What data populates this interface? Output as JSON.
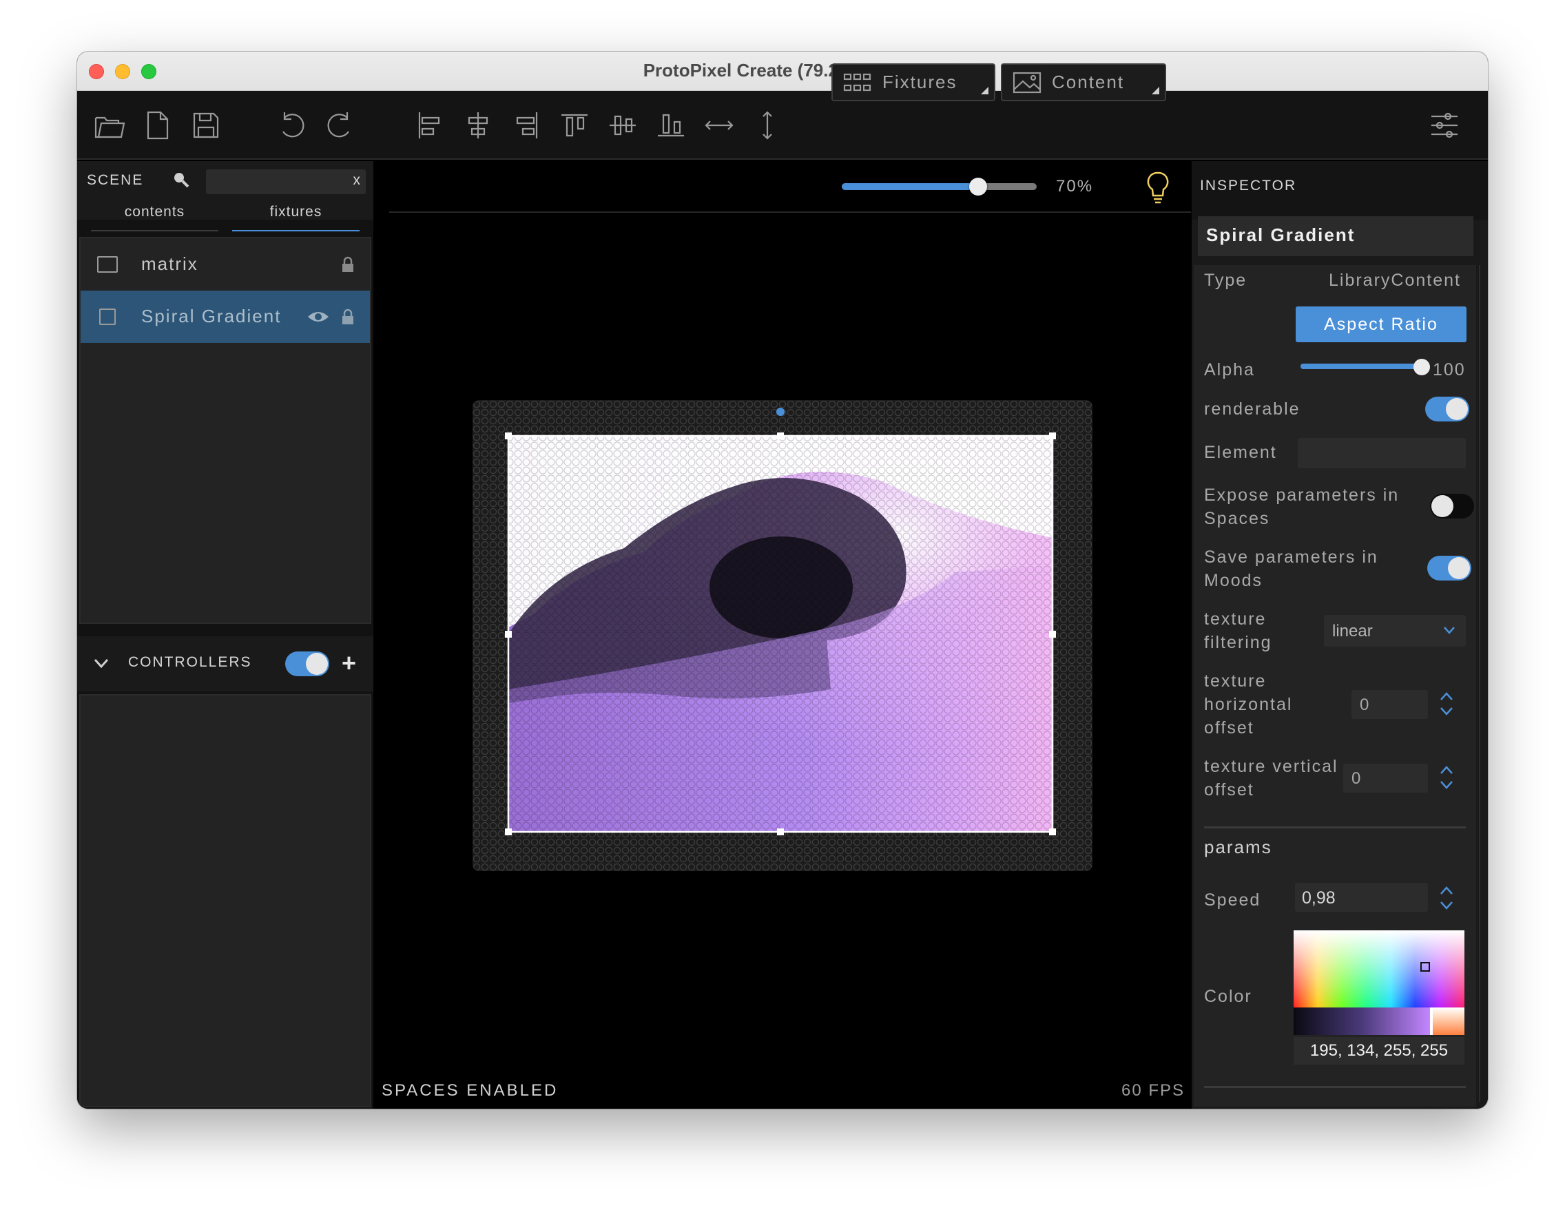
{
  "window": {
    "title": "ProtoPixel Create (79.2 days left)"
  },
  "toolbar": {
    "fixtures_label": "Fixtures",
    "content_label": "Content"
  },
  "scene": {
    "label": "SCENE",
    "search_clear": "x",
    "tabs": [
      {
        "label": "contents"
      },
      {
        "label": "fixtures"
      }
    ],
    "items": [
      {
        "label": "matrix",
        "selected": false
      },
      {
        "label": "Spiral Gradient",
        "selected": true
      }
    ]
  },
  "controllers": {
    "label": "CONTROLLERS",
    "enabled": true,
    "add": "+"
  },
  "viewport": {
    "zoom": "70%",
    "zoom_value": 0.7,
    "status": "SPACES ENABLED",
    "fps": "60 FPS"
  },
  "inspector": {
    "label": "INSPECTOR",
    "object_title": "Spiral Gradient",
    "type_label": "Type",
    "type_value": "LibraryContent",
    "aspect_button": "Aspect Ratio",
    "alpha_label": "Alpha",
    "alpha_value": "100",
    "renderable_label": "renderable",
    "renderable": true,
    "element_label": "Element",
    "expose_label": "Expose parameters in Spaces",
    "expose": false,
    "save_label": "Save parameters in Moods",
    "save": true,
    "filtering_label": "texture filtering",
    "filtering_value": "linear",
    "hoffset_label": "texture horizontal offset",
    "hoffset_value": "0",
    "voffset_label": "texture vertical offset",
    "voffset_value": "0",
    "params_label": "params",
    "speed_label": "Speed",
    "speed_value": "0,98",
    "color_label": "Color",
    "color_values": "195, 134, 255, 255",
    "color_rgba": [
      195,
      134,
      255,
      255
    ]
  },
  "colors": {
    "accent": "#4a90d9",
    "selected_row": "#2c5577",
    "panel_bg": "#232323"
  }
}
